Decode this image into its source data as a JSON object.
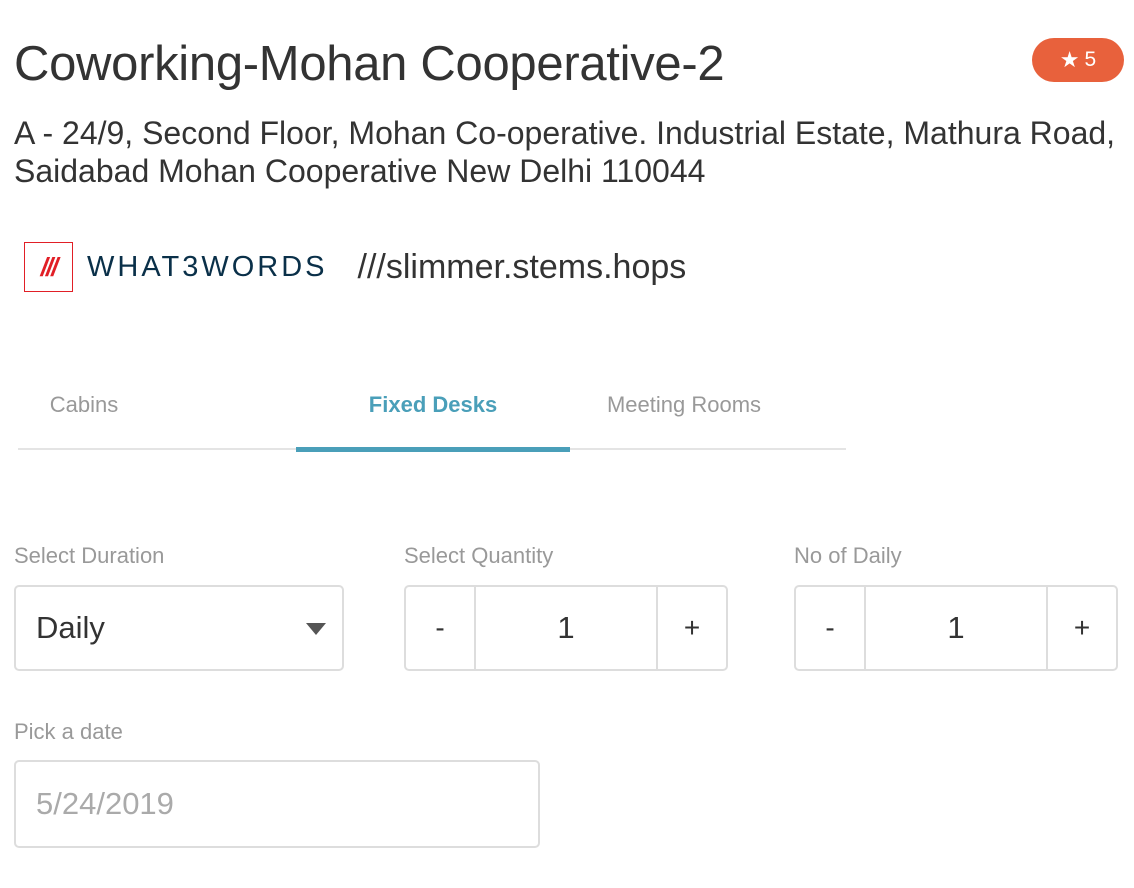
{
  "header": {
    "title": "Coworking-Mohan Cooperative-2",
    "rating": "5",
    "rating_icon": "star-icon",
    "accent_color": "#e8613c"
  },
  "address": "A - 24/9, Second Floor, Mohan Co-operative. Industrial Estate, Mathura Road, Saidabad Mohan Cooperative New Delhi 110044",
  "what3words": {
    "logo_text": "///",
    "brand": "WHAT3WORDS",
    "address": "///slimmer.stems.hops",
    "brand_color": "#e11f26"
  },
  "tabs": [
    {
      "label": "Cabins",
      "active": false
    },
    {
      "label": "Fixed Desks",
      "active": true
    },
    {
      "label": "Meeting Rooms",
      "active": false
    }
  ],
  "tab_accent_color": "#4a9fb9",
  "form": {
    "duration": {
      "label": "Select Duration",
      "value": "Daily"
    },
    "quantity": {
      "label": "Select Quantity",
      "value": "1",
      "minus": "-",
      "plus": "+"
    },
    "daily": {
      "label": "No of Daily",
      "value": "1",
      "minus": "-",
      "plus": "+"
    },
    "date": {
      "label": "Pick a date",
      "placeholder": "5/24/2019"
    }
  }
}
